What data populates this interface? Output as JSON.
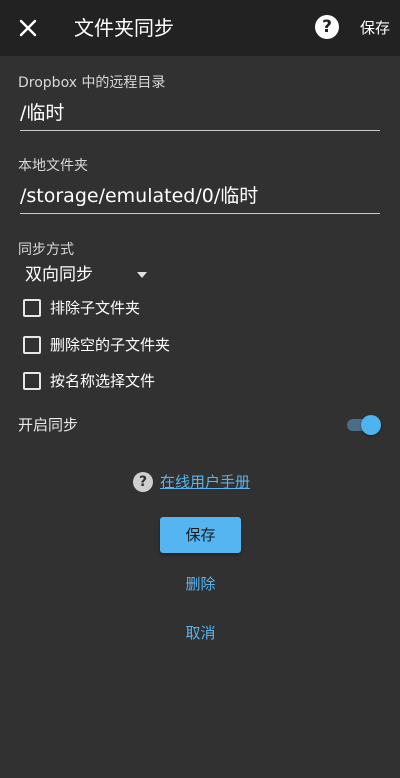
{
  "appbar": {
    "title": "文件夹同步",
    "save_label": "保存",
    "help_glyph": "?"
  },
  "remote": {
    "label": "Dropbox 中的远程目录",
    "value": "/临时"
  },
  "local": {
    "label": "本地文件夹",
    "value": "/storage/emulated/0/临时"
  },
  "sync_method": {
    "label": "同步方式",
    "selected": "双向同步"
  },
  "options": [
    {
      "label": "排除子文件夹",
      "checked": false
    },
    {
      "label": "删除空的子文件夹",
      "checked": false
    },
    {
      "label": "按名称选择文件",
      "checked": false
    }
  ],
  "enable_sync": {
    "label": "开启同步",
    "on": true
  },
  "manual": {
    "icon_glyph": "?",
    "link_text": "在线用户手册"
  },
  "actions": {
    "save": "保存",
    "delete": "删除",
    "cancel": "取消"
  },
  "colors": {
    "background": "#313131",
    "appbar": "#222222",
    "accent": "#54b5f0",
    "link": "#59b4ee"
  }
}
